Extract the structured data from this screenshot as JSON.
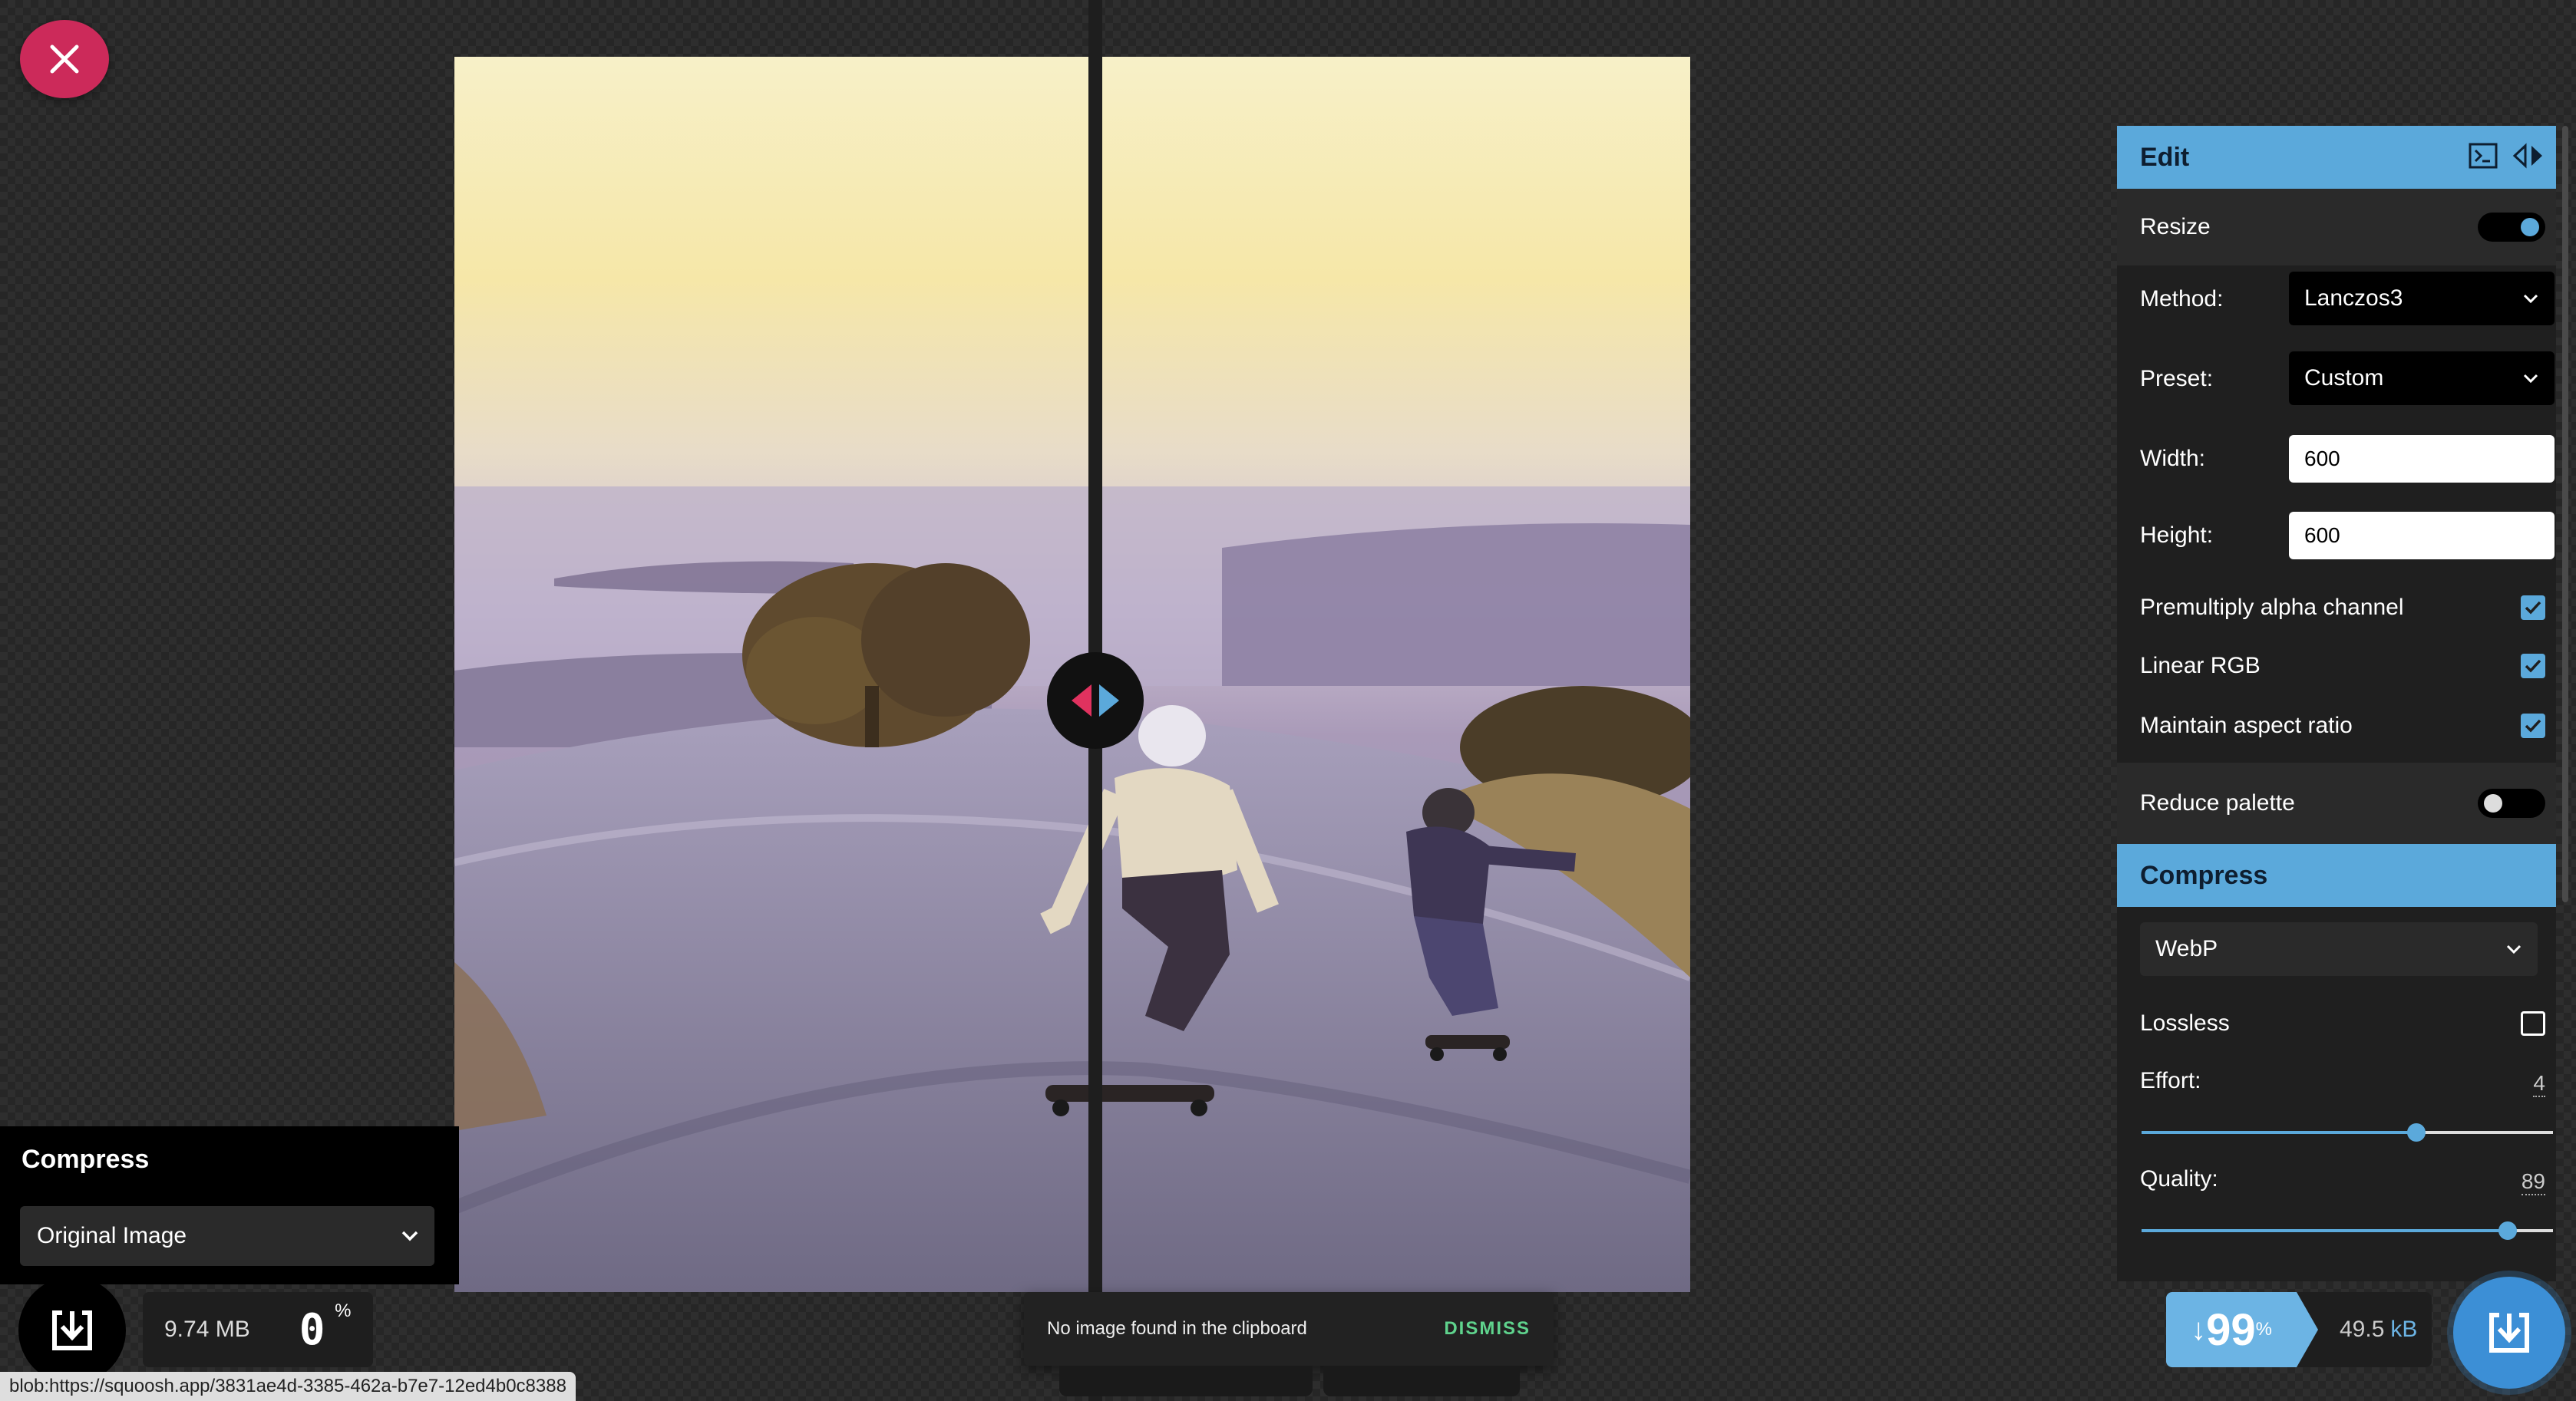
{
  "close": {
    "icon": "close-icon",
    "color": "#cc2a5a"
  },
  "left_panel": {
    "title": "Compress",
    "codec": "Original Image",
    "file_size": "9.74 MB",
    "percent_value": "0",
    "percent_sign": "%"
  },
  "toast": {
    "message": "No image found in the clipboard",
    "dismiss": "DISMISS"
  },
  "url": "blob:https://squoosh.app/3831ae4d-3385-462a-b7e7-12ed4b0c8388",
  "edit_panel": {
    "title": "Edit",
    "resize_label": "Resize",
    "resize_on": true,
    "method_label": "Method:",
    "method_value": "Lanczos3",
    "preset_label": "Preset:",
    "preset_value": "Custom",
    "width_label": "Width:",
    "width_value": "600",
    "height_label": "Height:",
    "height_value": "600",
    "premultiply_label": "Premultiply alpha channel",
    "premultiply_checked": true,
    "linear_rgb_label": "Linear RGB",
    "linear_rgb_checked": true,
    "aspect_label": "Maintain aspect ratio",
    "aspect_checked": true,
    "reduce_palette_label": "Reduce palette",
    "reduce_palette_on": false
  },
  "compress_panel": {
    "title": "Compress",
    "codec": "WebP",
    "lossless_label": "Lossless",
    "lossless_checked": false,
    "effort_label": "Effort:",
    "effort_value": "4",
    "effort_fraction": 0.667,
    "quality_label": "Quality:",
    "quality_value": "89",
    "quality_fraction": 0.89
  },
  "result": {
    "arrow": "↓",
    "percent_value": "99",
    "percent_sign": "%",
    "size_value": "49.5",
    "size_unit": "kB"
  },
  "colors": {
    "accent": "#5ba9db",
    "download": "#3c8fd6",
    "dismiss": "#5fd38d"
  }
}
